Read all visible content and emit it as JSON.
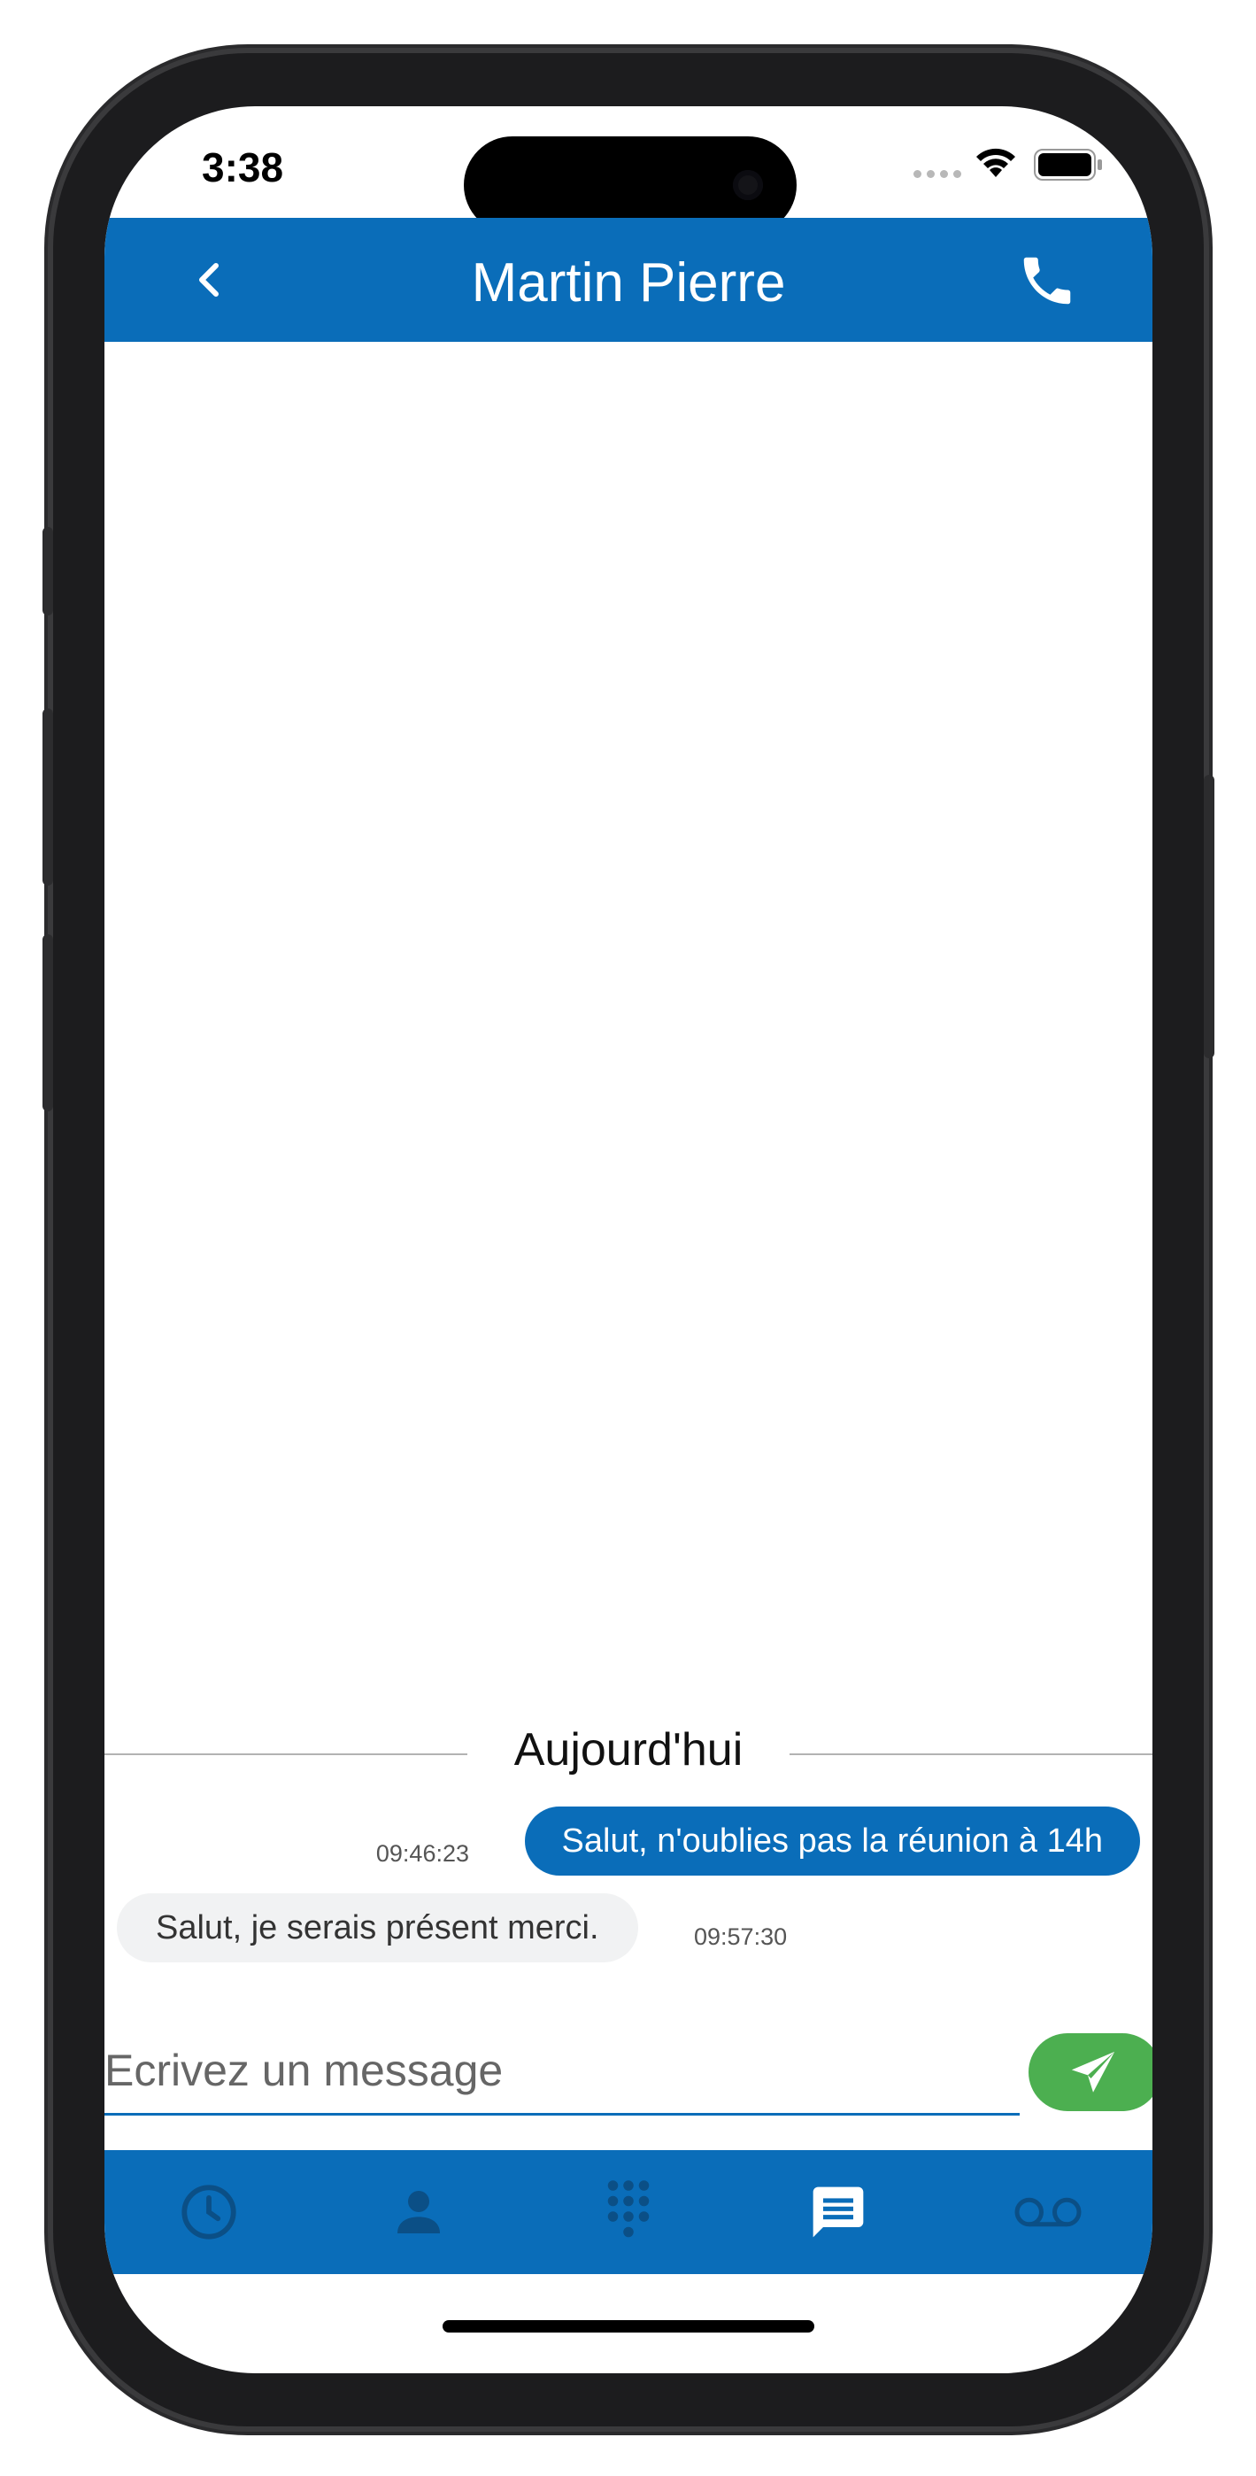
{
  "status_bar": {
    "time": "3:38"
  },
  "header": {
    "title": "Martin Pierre"
  },
  "conversation": {
    "day_label": "Aujourd'hui",
    "messages": [
      {
        "direction": "outgoing",
        "text": "Salut, n'oublies pas la réunion à 14h",
        "time": "09:46:23"
      },
      {
        "direction": "incoming",
        "text": "Salut, je serais présent merci.",
        "time": "09:57:30"
      }
    ]
  },
  "composer": {
    "placeholder": "Ecrivez un message",
    "value": ""
  },
  "bottom_nav": {
    "items": [
      {
        "icon": "clock-icon",
        "active": false
      },
      {
        "icon": "person-icon",
        "active": false
      },
      {
        "icon": "dialpad-icon",
        "active": false
      },
      {
        "icon": "message-icon",
        "active": true
      },
      {
        "icon": "voicemail-icon",
        "active": false
      }
    ]
  },
  "colors": {
    "primary": "#0a6db9",
    "send_button": "#4caf50",
    "incoming_bubble": "#f1f2f3",
    "nav_inactive_icon": "#0b4f86",
    "nav_active_icon": "#ffffff"
  }
}
